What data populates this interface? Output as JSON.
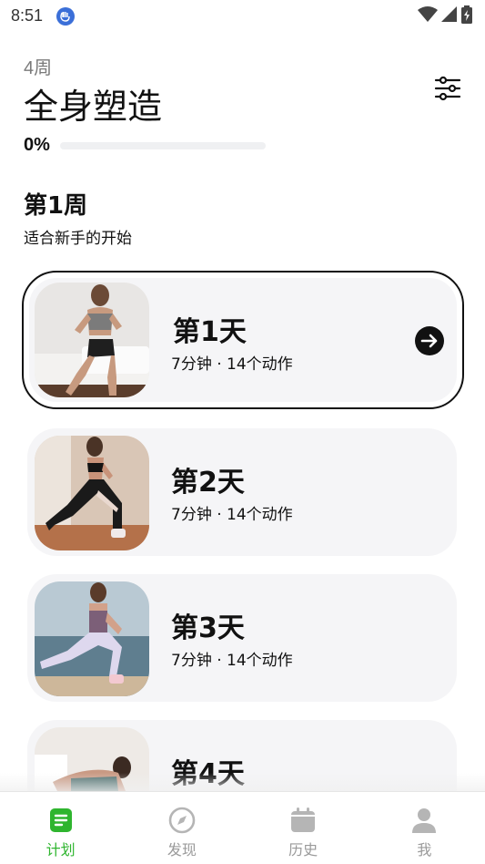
{
  "status_bar": {
    "time": "8:51",
    "icons": [
      "app-notification-icon",
      "wifi-icon",
      "signal-icon",
      "battery-charging-icon"
    ]
  },
  "header": {
    "weeks_label": "4周",
    "title": "全身塑造",
    "filter_icon": "sliders-icon"
  },
  "progress": {
    "label": "0%",
    "value": 0
  },
  "week": {
    "title": "第1周",
    "description": "适合新手的开始"
  },
  "days": [
    {
      "title": "第1天",
      "meta": "7分钟 · 14个动作",
      "image": "woman-exercising-squat-photo",
      "active": true
    },
    {
      "title": "第2天",
      "meta": "7分钟 · 14个动作",
      "image": "woman-lunge-photo",
      "active": false
    },
    {
      "title": "第3天",
      "meta": "7分钟 · 14个动作",
      "image": "woman-side-lunge-by-sea-photo",
      "active": false
    },
    {
      "title": "第4天",
      "meta": "",
      "image": "woman-stretch-photo",
      "active": false
    }
  ],
  "nav": {
    "items": [
      {
        "label": "计划",
        "icon": "plan-document-icon",
        "active": true
      },
      {
        "label": "发现",
        "icon": "compass-icon",
        "active": false
      },
      {
        "label": "历史",
        "icon": "calendar-icon",
        "active": false
      },
      {
        "label": "我",
        "icon": "person-icon",
        "active": false
      }
    ]
  },
  "colors": {
    "accent_green": "#2fb52f",
    "card_bg": "#f5f5f7",
    "text_primary": "#111111",
    "text_muted": "#9a9a9a"
  }
}
